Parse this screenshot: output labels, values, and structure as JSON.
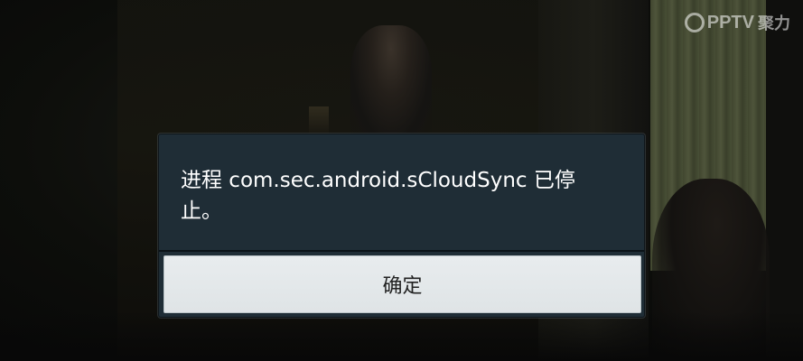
{
  "watermark": {
    "brand": "PPTV",
    "suffix": "聚力"
  },
  "dialog": {
    "message": "进程 com.sec.android.sCloudSync 已停止。",
    "ok_label": "确定"
  },
  "colors": {
    "dialog_background": "#1f2d36",
    "button_background": "#e3e8ea",
    "message_text": "#ffffff"
  }
}
